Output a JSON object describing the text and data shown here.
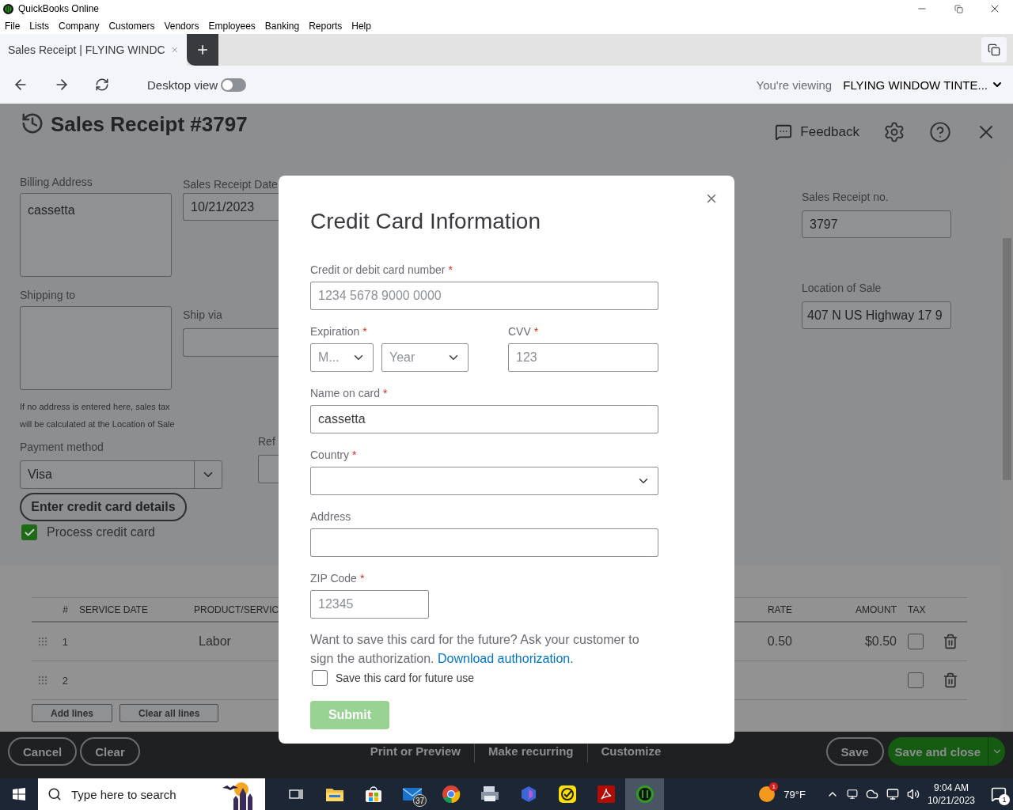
{
  "window": {
    "title": "QuickBooks Online"
  },
  "menu": [
    "File",
    "Lists",
    "Company",
    "Customers",
    "Vendors",
    "Employees",
    "Banking",
    "Reports",
    "Help"
  ],
  "browser_tabs": [
    {
      "label": "Sales Receipt | FLYING WINDC",
      "selected": true
    }
  ],
  "nav": {
    "desktop_view_label": "Desktop view",
    "desktop_view_on": false,
    "viewing_label": "You're viewing",
    "company": "FLYING WINDOW TINTE..."
  },
  "page": {
    "title": "Sales Receipt #3797",
    "feedback": "Feedback"
  },
  "form": {
    "billing_address": {
      "label": "Billing Address",
      "value": "cassetta"
    },
    "shipping_to": {
      "label": "Shipping to"
    },
    "address_note": "If no address is entered here, sales tax will be calculated at the Location of Sale",
    "payment_method": {
      "label": "Payment method",
      "value": "Visa"
    },
    "enter_card_button": "Enter credit card details",
    "process_credit_card": {
      "label": "Process credit card",
      "checked": true
    },
    "sales_receipt_date": {
      "label": "Sales Receipt Date",
      "value": "10/21/2023"
    },
    "ship_via": {
      "label": "Ship via"
    },
    "reference": {
      "label": "Ref"
    },
    "sales_receipt_no": {
      "label": "Sales Receipt no.",
      "value": "3797"
    },
    "location_of_sale": {
      "label": "Location of Sale",
      "value": "407 N US Highway 17 9"
    }
  },
  "table": {
    "columns": [
      "#",
      "SERVICE DATE",
      "PRODUCT/SERVIC",
      "RATE",
      "AMOUNT",
      "TAX"
    ],
    "rows": [
      {
        "number": "1",
        "product": "Labor",
        "rate": "0.50",
        "amount": "$0.50",
        "tax": false
      },
      {
        "number": "2",
        "tax": false
      }
    ],
    "buttons": [
      "Add lines",
      "Clear all lines"
    ]
  },
  "footer": {
    "left": [
      "Cancel",
      "Clear"
    ],
    "center": [
      "Print or Preview",
      "Make recurring",
      "Customize"
    ],
    "save": "Save",
    "save_and_close": "Save and close"
  },
  "modal": {
    "title": "Credit Card Information",
    "card_number": {
      "label": "Credit or debit card number",
      "required_mark": "*",
      "placeholder": "1234 5678 9000 0000"
    },
    "expiration": {
      "label": "Expiration",
      "required_mark": "*",
      "month_placeholder": "M...",
      "year_placeholder": "Year"
    },
    "cvv": {
      "label": "CVV",
      "required_mark": "*",
      "placeholder": "123"
    },
    "name_on_card": {
      "label": "Name on card",
      "required_mark": "*",
      "value": "cassetta"
    },
    "country": {
      "label": "Country",
      "required_mark": "*"
    },
    "address": {
      "label": "Address"
    },
    "zip": {
      "label": "ZIP Code",
      "required_mark": "*",
      "placeholder": "12345"
    },
    "save_note": "Want to save this card for the future? Ask your customer to sign the authorization.",
    "save_note_link": "Download authorization.",
    "save_card": {
      "label": "Save this card for future use",
      "checked": false
    },
    "submit": {
      "label": "Submit",
      "disabled": true
    }
  },
  "taskbar": {
    "search_placeholder": "Type here to search",
    "apps": [
      {
        "kind": "taskview",
        "selected": false
      },
      {
        "kind": "explorer",
        "selected": false
      },
      {
        "kind": "store",
        "selected": false
      },
      {
        "kind": "mail",
        "badge": "37",
        "selected": false
      },
      {
        "kind": "chrome",
        "selected": false
      },
      {
        "kind": "scanner",
        "selected": false
      },
      {
        "kind": "copilot",
        "selected": false
      },
      {
        "kind": "norton",
        "selected": false
      },
      {
        "kind": "acrobat",
        "selected": false
      },
      {
        "kind": "quickbooks",
        "selected": true
      }
    ],
    "weather_badge": "1",
    "temperature": "79°F",
    "time": "9:04 AM",
    "date": "10/21/2023",
    "notifications": "1"
  }
}
